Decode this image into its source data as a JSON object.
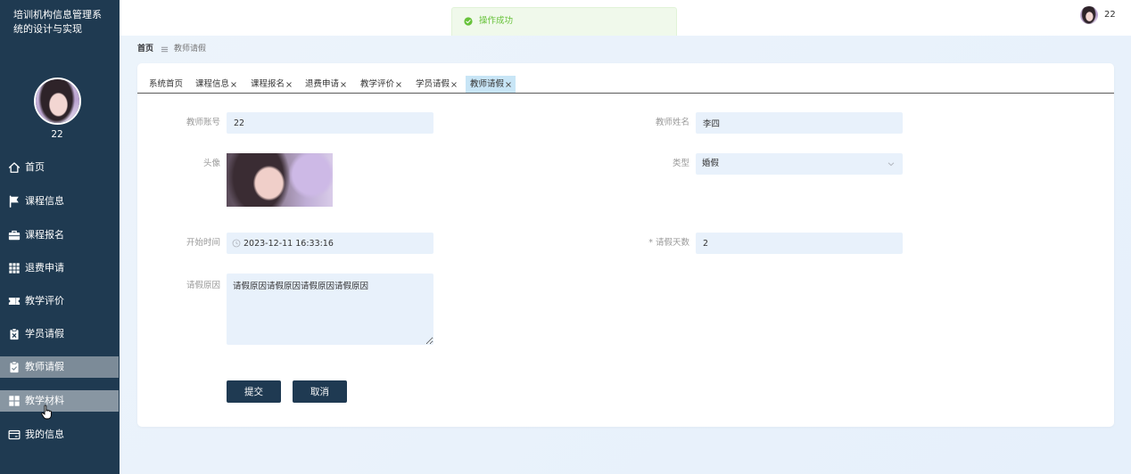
{
  "colors": {
    "sidebar_bg": "#1f3a51",
    "primary_button": "#1f3a52",
    "success": "#67c23a",
    "active_tab_bg": "#c8e5f6",
    "input_bg": "#e8f1fb",
    "page_bg": "#edf4fb"
  },
  "sidebar": {
    "title": "培训机构信息管理系统的设计与实现",
    "username": "22",
    "items": [
      {
        "label": "首页",
        "icon": "home-icon"
      },
      {
        "label": "课程信息",
        "icon": "flag-icon"
      },
      {
        "label": "课程报名",
        "icon": "briefcase-icon"
      },
      {
        "label": "退费申请",
        "icon": "grid-icon"
      },
      {
        "label": "教学评价",
        "icon": "ticket-icon"
      },
      {
        "label": "学员请假",
        "icon": "clipboard-x-icon"
      },
      {
        "label": "教师请假",
        "icon": "clipboard-check-icon",
        "active": true
      },
      {
        "label": "教学材料",
        "icon": "apps-icon",
        "hovered": true
      },
      {
        "label": "我的信息",
        "icon": "id-card-icon"
      }
    ]
  },
  "header": {
    "toast": {
      "type": "success",
      "icon": "success-check-icon",
      "message": "操作成功"
    },
    "username": "22"
  },
  "breadcrumb": {
    "home": "首页",
    "separator_icon": "menu-icon",
    "current": "教师请假"
  },
  "tabs": [
    {
      "label": "系统首页",
      "closable": false
    },
    {
      "label": "课程信息",
      "closable": true
    },
    {
      "label": "课程报名",
      "closable": true
    },
    {
      "label": "退费申请",
      "closable": true
    },
    {
      "label": "教学评价",
      "closable": true
    },
    {
      "label": "学员请假",
      "closable": true
    },
    {
      "label": "教师请假",
      "closable": true,
      "active": true
    }
  ],
  "form": {
    "teacher_account": {
      "label": "教师账号",
      "value": "22"
    },
    "teacher_name": {
      "label": "教师姓名",
      "value": "李四"
    },
    "avatar": {
      "label": "头像"
    },
    "leave_type": {
      "label": "类型",
      "value": "婚假",
      "icon": "chevron-down-icon"
    },
    "start_time": {
      "label": "开始时间",
      "value": "2023-12-11 16:33:16",
      "icon": "clock-icon"
    },
    "leave_days": {
      "label": "请假天数",
      "required_mark": "*",
      "value": "2"
    },
    "reason": {
      "label": "请假原因",
      "value": "请假原因请假原因请假原因请假原因"
    }
  },
  "actions": {
    "submit_label": "提交",
    "cancel_label": "取消"
  }
}
